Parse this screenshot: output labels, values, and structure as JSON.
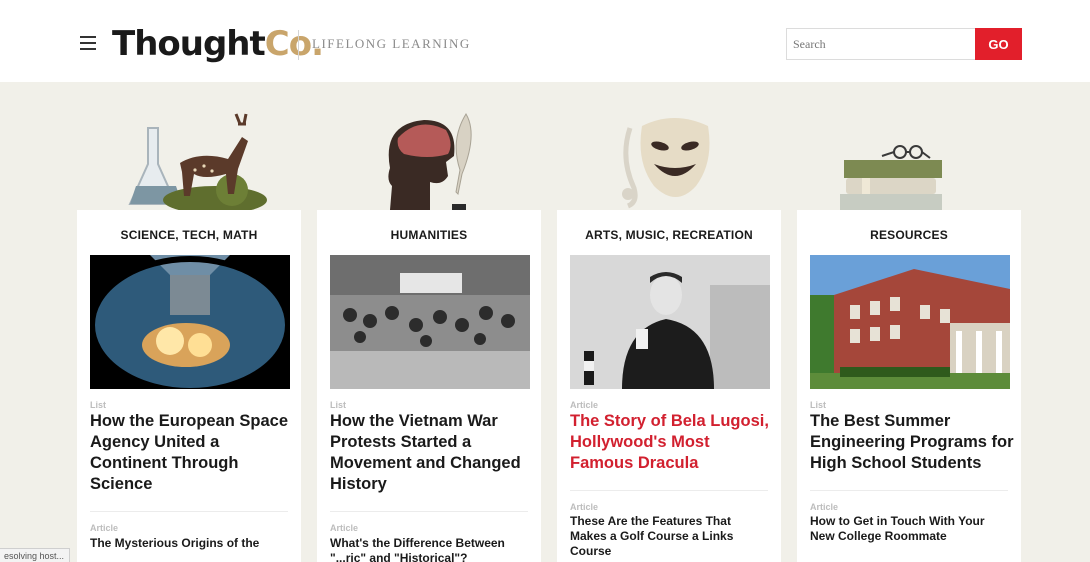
{
  "header": {
    "logo_main": "Thought",
    "logo_co": "Co.",
    "tagline": "LIFELONG LEARNING",
    "search_placeholder": "Search",
    "go_label": "GO"
  },
  "colors": {
    "accent_red": "#e21f2b",
    "logo_gold": "#c9a56b",
    "background": "#f1f0e9"
  },
  "cards": [
    {
      "category": "SCIENCE, TECH, MATH",
      "type": "List",
      "title": "How the European Space Agency United a Continent Through Science",
      "sub_type": "Article",
      "sub_title": "The Mysterious Origins of the"
    },
    {
      "category": "HUMANITIES",
      "type": "List",
      "title": "How the Vietnam War Protests Started a Movement and Changed History",
      "sub_type": "Article",
      "sub_title": "What's the Difference Between \"...ric\" and \"Historical\"?"
    },
    {
      "category": "ARTS, MUSIC, RECREATION",
      "type": "Article",
      "title": "The Story of Bela Lugosi, Hollywood's Most Famous Dracula",
      "sub_type": "Article",
      "sub_title": "These Are the Features That Makes a Golf Course a Links Course"
    },
    {
      "category": "RESOURCES",
      "type": "List",
      "title": "The Best Summer Engineering Programs for High School Students",
      "sub_type": "Article",
      "sub_title": "How to Get in Touch With Your New College Roommate"
    }
  ],
  "status_bar": "esolving host..."
}
